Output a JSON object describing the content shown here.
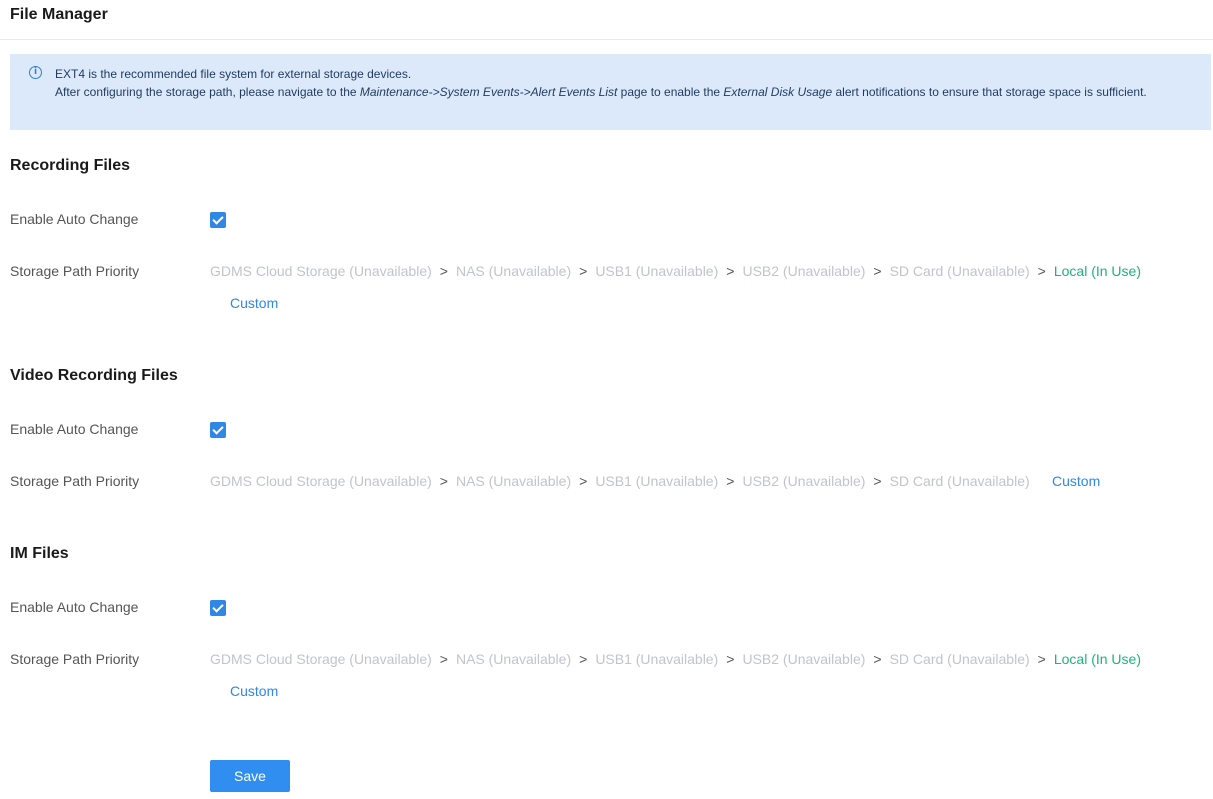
{
  "header": {
    "title": "File Manager"
  },
  "notice": {
    "icon": "info-icon",
    "line1": "EXT4 is the recommended file system for external storage devices.",
    "line2_a": "After configuring the storage path, please navigate to the ",
    "line2_link": "Maintenance->System Events->Alert Events List",
    "line2_b": " page to enable the ",
    "line2_em": "External Disk Usage",
    "line2_c": " alert notifications to ensure that storage space is sufficient."
  },
  "sections": [
    {
      "title": "Recording Files",
      "auto_change_label": "Enable Auto Change",
      "auto_change_checked": true,
      "path_label": "Storage Path Priority",
      "paths": [
        "GDMS Cloud Storage (Unavailable)",
        "NAS (Unavailable)",
        "USB1 (Unavailable)",
        "USB2 (Unavailable)",
        "SD Card (Unavailable)",
        "Local (In Use)"
      ],
      "custom_label": "Custom"
    },
    {
      "title": "Video Recording Files",
      "auto_change_label": "Enable Auto Change",
      "auto_change_checked": true,
      "path_label": "Storage Path Priority",
      "paths": [
        "GDMS Cloud Storage (Unavailable)",
        "NAS (Unavailable)",
        "USB1 (Unavailable)",
        "USB2 (Unavailable)",
        "SD Card (Unavailable)"
      ],
      "custom_label": "Custom"
    },
    {
      "title": "IM Files",
      "auto_change_label": "Enable Auto Change",
      "auto_change_checked": true,
      "path_label": "Storage Path Priority",
      "paths": [
        "GDMS Cloud Storage (Unavailable)",
        "NAS (Unavailable)",
        "USB1 (Unavailable)",
        "USB2 (Unavailable)",
        "SD Card (Unavailable)",
        "Local (In Use)"
      ],
      "custom_label": "Custom"
    }
  ],
  "path_separator": ">",
  "save_label": "Save",
  "colors": {
    "accent": "#2f87e6",
    "in_use": "#1db37a",
    "unavailable": "#c0c4cc",
    "notice_bg": "#dbe9fb"
  }
}
